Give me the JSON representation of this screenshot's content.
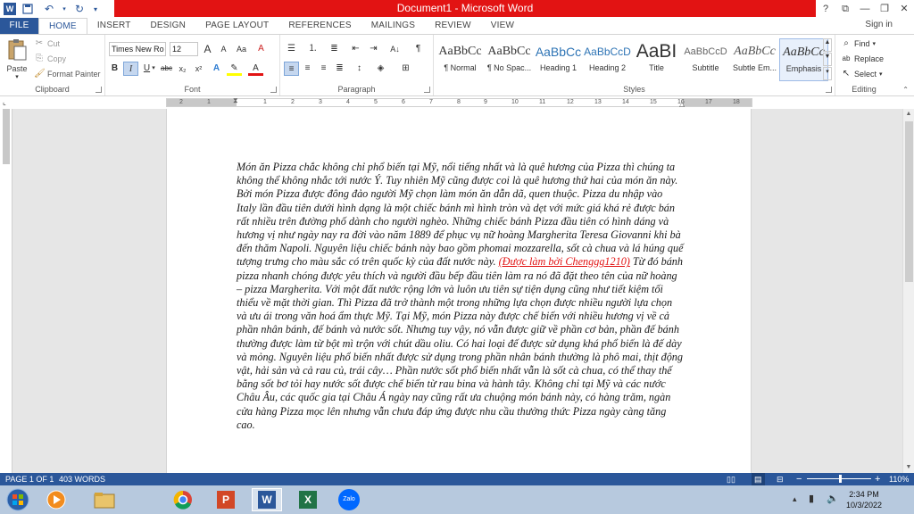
{
  "window": {
    "title": "Document1 - Microsoft Word",
    "buttons": {
      "help": "?",
      "ribbon_opts": "⧉",
      "minimize": "—",
      "restore": "❐",
      "close": "✕"
    }
  },
  "qat": {
    "save_icon": "save-icon",
    "undo_icon": "undo-icon",
    "redo_icon": "redo-icon"
  },
  "tabs": [
    "FILE",
    "HOME",
    "INSERT",
    "DESIGN",
    "PAGE LAYOUT",
    "REFERENCES",
    "MAILINGS",
    "REVIEW",
    "VIEW"
  ],
  "active_tab": "HOME",
  "signin": "Sign in",
  "clipboard": {
    "label": "Clipboard",
    "paste": "Paste",
    "cut": "Cut",
    "copy": "Copy",
    "format_painter": "Format Painter"
  },
  "font": {
    "label": "Font",
    "name": "Times New Ro",
    "size": "12",
    "grow": "A",
    "shrink": "A",
    "case": "Aa",
    "clear": "A"
  },
  "paragraph": {
    "label": "Paragraph"
  },
  "styles": {
    "label": "Styles",
    "items": [
      {
        "preview": "AaBbCc",
        "name": "¶ Normal"
      },
      {
        "preview": "AaBbCc",
        "name": "¶ No Spac..."
      },
      {
        "preview": "AaBbCc",
        "name": "Heading 1"
      },
      {
        "preview": "AaBbCcD",
        "name": "Heading 2"
      },
      {
        "preview": "AaBI",
        "name": "Title"
      },
      {
        "preview": "AaBbCcD",
        "name": "Subtitle"
      },
      {
        "preview": "AaBbCc",
        "name": "Subtle Em..."
      },
      {
        "preview": "AaBbCc",
        "name": "Emphasis"
      }
    ]
  },
  "editing": {
    "label": "Editing",
    "find": "Find",
    "replace": "Replace",
    "select": "Select"
  },
  "ruler": {
    "ticks": [
      "2",
      "1",
      "1",
      "2",
      "3",
      "4",
      "5",
      "6",
      "7",
      "8",
      "9",
      "10",
      "11",
      "12",
      "13",
      "14",
      "15",
      "16",
      "17",
      "18"
    ]
  },
  "document": {
    "text_before": "Món ăn Pizza chắc không chỉ phổ biến tại Mỹ, nổi tiếng nhất và là quê hương của Pizza thì chúng ta không thể không nhắc tới nước Ý. Tuy nhiên Mỹ cũng được coi là quê hương thứ hai của món ăn này. Bởi món Pizza được đông đảo người Mỹ chọn làm món ăn dẫn dã, quen thuộc. Pizza du nhập vào Italy lần đầu tiên dưới hình dạng là một chiếc bánh mì hình tròn và dẹt với mức giá khá rẻ được bán rất nhiều trên đường phố dành cho người nghèo. Những chiếc bánh Pizza đầu tiên có hình dáng và hương vị như ngày nay ra đời vào năm 1889 để phục vụ nữ hoàng Margherita Teresa Giovanni khi bà đến thăm Napoli. Nguyên liệu chiếc bánh này bao gồm phomai mozzarella, sốt cà chua và lá húng quế tượng trưng cho màu sắc có trên quốc kỳ của đất nước này. ",
    "tracked": "(Được làm bởi Chenggg1210)",
    "text_after": " Từ đó bánh pizza nhanh chóng được yêu thích và người đầu bếp đầu tiên làm ra nó đã đặt theo tên của nữ hoàng – pizza Margherita. Với một đất nước rộng lớn và luôn ưu tiên sự tiện dụng cũng như tiết kiệm tối thiểu về mặt thời gian. Thì Pizza đã trở thành một trong những lựa chọn được nhiều người lựa chọn và ưu ái trong văn hoá ẩm thực Mỹ. Tại Mỹ, món Pizza này được chế biến với nhiều hương vị về cả phần nhân bánh, đế bánh và nước sốt. Nhưng tuy vậy, nó vẫn được giữ về phần cơ bản, phần đế bánh thường được làm từ bột mì trộn với chút dầu oliu. Có hai loại đế được sử dụng khá phổ biến là đế dày và mỏng. Nguyên liệu phổ biến nhất được sử dụng trong phần nhân bánh thường là phô mai, thịt động vật, hải sản và cả rau củ, trái cây… Phần nước sốt phổ biến nhất vẫn là sốt cà chua, có thể thay thế bằng sốt bơ tỏi hay nước sốt được chế biến từ rau bina và hành tây. Không chỉ tại Mỹ và các nước Châu Âu, các quốc gia tại Châu Á ngày nay cũng rất ưa chuộng món bánh này, có hàng trăm, ngàn cửa hàng Pizza mọc lên nhưng vẫn chưa đáp ứng được nhu cầu thưởng thức Pizza ngày càng tăng cao."
  },
  "status": {
    "page": "PAGE 1 OF 1",
    "words": "403 WORDS",
    "zoom": "110%",
    "zoom_minus": "−",
    "zoom_plus": "+"
  },
  "taskbar": {
    "start_icon": "windows-start-icon",
    "apps": [
      "file-explorer-icon",
      "media-player-icon",
      "chrome-icon",
      "powerpoint-icon",
      "word-icon",
      "excel-icon",
      "zalo-icon"
    ],
    "zalo_label": "Zalo",
    "ppt_letter": "P",
    "word_letter": "W",
    "excel_letter": "X",
    "time": "2:34 PM",
    "date": "10/3/2022"
  }
}
